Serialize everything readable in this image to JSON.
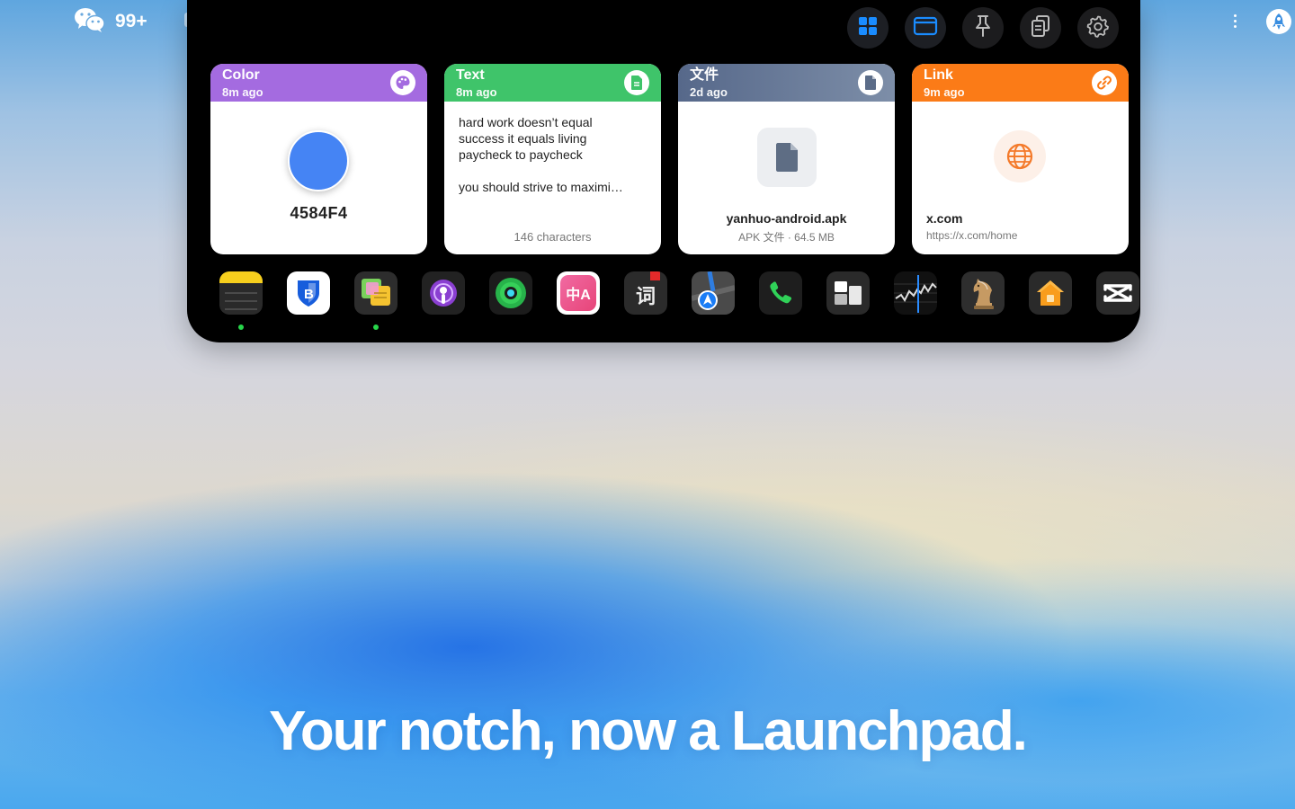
{
  "menubar": {
    "wechat_badge": "99+",
    "icons": [
      "wechat-icon",
      "more-dots-icon",
      "rocket-icon"
    ]
  },
  "toolbar": {
    "buttons": [
      {
        "name": "grid-view",
        "icon": "grid-icon",
        "active": true
      },
      {
        "name": "window-view",
        "icon": "window-icon",
        "active": true
      },
      {
        "name": "pin",
        "icon": "pin-icon",
        "active": false
      },
      {
        "name": "clipboard",
        "icon": "clipboard-icon",
        "active": false
      },
      {
        "name": "settings",
        "icon": "gear-icon",
        "active": false
      }
    ]
  },
  "cards": {
    "color": {
      "type": "Color",
      "time": "8m ago",
      "hex": "4584F4",
      "swatch": "#4584F4",
      "header_color": "#a46be0"
    },
    "text": {
      "type": "Text",
      "time": "8m ago",
      "content": "hard work doesn’t equal\nsuccess it equals living\npaycheck to paycheck\n\nyou should strive to maximi…",
      "count": "146 characters",
      "header_color": "#3fc46a"
    },
    "file": {
      "type": "文件",
      "time": "2d ago",
      "name": "yanhuo-android.apk",
      "meta": "APK 文件 · 64.5 MB",
      "header_color": "#60738e"
    },
    "link": {
      "type": "Link",
      "time": "9m ago",
      "domain": "x.com",
      "url": "https://x.com/home",
      "header_color": "#fb7b17"
    }
  },
  "dock": {
    "apps": [
      {
        "name": "notes",
        "running": true
      },
      {
        "name": "bitwarden",
        "running": false
      },
      {
        "name": "stickies",
        "running": true
      },
      {
        "name": "podcasts",
        "running": false
      },
      {
        "name": "find-my",
        "running": false
      },
      {
        "name": "translate",
        "running": false
      },
      {
        "name": "dictionary",
        "running": false,
        "label": "词"
      },
      {
        "name": "maps",
        "running": false
      },
      {
        "name": "phone",
        "running": false
      },
      {
        "name": "window-manager",
        "running": false
      },
      {
        "name": "stocks",
        "running": false
      },
      {
        "name": "chess",
        "running": false
      },
      {
        "name": "home",
        "running": false
      },
      {
        "name": "capcut",
        "running": false
      }
    ]
  },
  "tagline": "Your notch, now a Launchpad."
}
